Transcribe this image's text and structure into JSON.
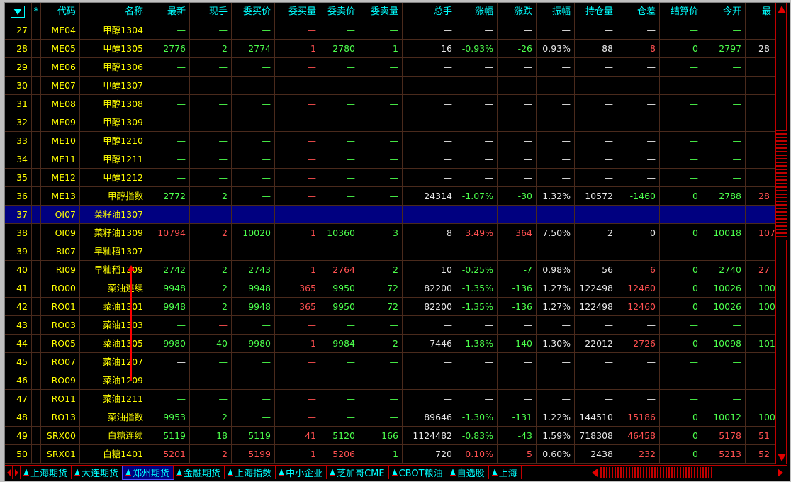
{
  "columns": [
    "",
    "*",
    "代码",
    "名称",
    "最新",
    "现手",
    "委买价",
    "委买量",
    "委卖价",
    "委卖量",
    "总手",
    "涨幅",
    "涨跌",
    "振幅",
    "持仓量",
    "仓差",
    "结算价",
    "今开",
    "最"
  ],
  "colors": {
    "g": "#4cff4c",
    "r": "#ff5050",
    "w": "#e8e8e8",
    "y": "#ffff00",
    "selected_row_bg": "#000080"
  },
  "selected_index": "37",
  "rows": [
    {
      "v": [
        "27",
        "",
        "ME04",
        "甲醇1304",
        "—",
        "—",
        "—",
        "—",
        "—",
        "—",
        "—",
        "—",
        "—",
        "—",
        "—",
        "—",
        "—",
        "—",
        ""
      ],
      "c": "gggrggwwwwwwggw"
    },
    {
      "v": [
        "28",
        "",
        "ME05",
        "甲醇1305",
        "2776",
        "2",
        "2774",
        "1",
        "2780",
        "1",
        "16",
        "-0.93%",
        "-26",
        "0.93%",
        "88",
        "8",
        "0",
        "2797",
        "28"
      ],
      "c": "gggrggwggwwrggw"
    },
    {
      "v": [
        "29",
        "",
        "ME06",
        "甲醇1306",
        "—",
        "—",
        "—",
        "—",
        "—",
        "—",
        "—",
        "—",
        "—",
        "—",
        "—",
        "—",
        "—",
        "—",
        ""
      ],
      "c": "gggrggwwwwwwggw"
    },
    {
      "v": [
        "30",
        "",
        "ME07",
        "甲醇1307",
        "—",
        "—",
        "—",
        "—",
        "—",
        "—",
        "—",
        "—",
        "—",
        "—",
        "—",
        "—",
        "—",
        "—",
        ""
      ],
      "c": "gggrggwwwwwwggw"
    },
    {
      "v": [
        "31",
        "",
        "ME08",
        "甲醇1308",
        "—",
        "—",
        "—",
        "—",
        "—",
        "—",
        "—",
        "—",
        "—",
        "—",
        "—",
        "—",
        "—",
        "—",
        ""
      ],
      "c": "gggrggwwwwwwggw"
    },
    {
      "v": [
        "32",
        "",
        "ME09",
        "甲醇1309",
        "—",
        "—",
        "—",
        "—",
        "—",
        "—",
        "—",
        "—",
        "—",
        "—",
        "—",
        "—",
        "—",
        "—",
        ""
      ],
      "c": "gggrggwwwwwwggw"
    },
    {
      "v": [
        "33",
        "",
        "ME10",
        "甲醇1210",
        "—",
        "—",
        "—",
        "—",
        "—",
        "—",
        "—",
        "—",
        "—",
        "—",
        "—",
        "—",
        "—",
        "—",
        ""
      ],
      "c": "gggrggwwwwwwggw"
    },
    {
      "v": [
        "34",
        "",
        "ME11",
        "甲醇1211",
        "—",
        "—",
        "—",
        "—",
        "—",
        "—",
        "—",
        "—",
        "—",
        "—",
        "—",
        "—",
        "—",
        "—",
        ""
      ],
      "c": "gggrggwwwwwwggw"
    },
    {
      "v": [
        "35",
        "",
        "ME12",
        "甲醇1212",
        "—",
        "—",
        "—",
        "—",
        "—",
        "—",
        "—",
        "—",
        "—",
        "—",
        "—",
        "—",
        "—",
        "—",
        ""
      ],
      "c": "gggrggwwwwwwggw"
    },
    {
      "v": [
        "36",
        "",
        "ME13",
        "甲醇指数",
        "2772",
        "2",
        "—",
        "—",
        "—",
        "—",
        "24314",
        "-1.07%",
        "-30",
        "1.32%",
        "10572",
        "-1460",
        "0",
        "2788",
        "28"
      ],
      "c": "gggrggwggwwgggr"
    },
    {
      "v": [
        "37",
        "",
        "OI07",
        "菜籽油1307",
        "—",
        "—",
        "—",
        "—",
        "—",
        "—",
        "—",
        "—",
        "—",
        "—",
        "—",
        "—",
        "—",
        "—",
        ""
      ],
      "c": "gggrggwwwwwwggw"
    },
    {
      "v": [
        "38",
        "",
        "OI09",
        "菜籽油1309",
        "10794",
        "2",
        "10020",
        "1",
        "10360",
        "3",
        "8",
        "3.49%",
        "364",
        "7.50%",
        "2",
        "0",
        "0",
        "10018",
        "107"
      ],
      "c": "rrgrggwrrwwwggr"
    },
    {
      "v": [
        "39",
        "",
        "RI07",
        "早籼稻1307",
        "—",
        "—",
        "—",
        "—",
        "—",
        "—",
        "—",
        "—",
        "—",
        "—",
        "—",
        "—",
        "—",
        "—",
        ""
      ],
      "c": "gggrggwwwwwwggw"
    },
    {
      "v": [
        "40",
        "",
        "RI09",
        "早籼稻1309",
        "2742",
        "2",
        "2743",
        "1",
        "2764",
        "2",
        "10",
        "-0.25%",
        "-7",
        "0.98%",
        "56",
        "6",
        "0",
        "2740",
        "27"
      ],
      "c": "gggrrgwggwwrggr"
    },
    {
      "v": [
        "41",
        "",
        "RO00",
        "菜油连续",
        "9948",
        "2",
        "9948",
        "365",
        "9950",
        "72",
        "82200",
        "-1.35%",
        "-136",
        "1.27%",
        "122498",
        "12460",
        "0",
        "10026",
        "100"
      ],
      "c": "gggrggwggwwrggg"
    },
    {
      "v": [
        "42",
        "",
        "RO01",
        "菜油1301",
        "9948",
        "2",
        "9948",
        "365",
        "9950",
        "72",
        "82200",
        "-1.35%",
        "-136",
        "1.27%",
        "122498",
        "12460",
        "0",
        "10026",
        "100"
      ],
      "c": "gggrggwggwwrggg"
    },
    {
      "v": [
        "43",
        "",
        "RO03",
        "菜油1303",
        "—",
        "—",
        "—",
        "—",
        "—",
        "—",
        "—",
        "—",
        "—",
        "—",
        "—",
        "—",
        "—",
        "—",
        ""
      ],
      "c": "grgrggwwwwwwggw"
    },
    {
      "v": [
        "44",
        "",
        "RO05",
        "菜油1305",
        "9980",
        "40",
        "9980",
        "1",
        "9984",
        "2",
        "7446",
        "-1.38%",
        "-140",
        "1.30%",
        "22012",
        "2726",
        "0",
        "10098",
        "101"
      ],
      "c": "gggrggwggwwrggg"
    },
    {
      "v": [
        "45",
        "",
        "RO07",
        "菜油1207",
        "—",
        "—",
        "—",
        "—",
        "—",
        "—",
        "—",
        "—",
        "—",
        "—",
        "—",
        "—",
        "—",
        "—",
        ""
      ],
      "c": "wggrggwwwwwwggw"
    },
    {
      "v": [
        "46",
        "",
        "RO09",
        "菜油1209",
        "—",
        "—",
        "—",
        "—",
        "—",
        "—",
        "—",
        "—",
        "—",
        "—",
        "—",
        "—",
        "—",
        "—",
        ""
      ],
      "c": "rggrggwwwwwwggw"
    },
    {
      "v": [
        "47",
        "",
        "RO11",
        "菜油1211",
        "—",
        "—",
        "—",
        "—",
        "—",
        "—",
        "—",
        "—",
        "—",
        "—",
        "—",
        "—",
        "—",
        "—",
        ""
      ],
      "c": "gggrggwwwwwwggw"
    },
    {
      "v": [
        "48",
        "",
        "RO13",
        "菜油指数",
        "9953",
        "2",
        "—",
        "—",
        "—",
        "—",
        "89646",
        "-1.30%",
        "-131",
        "1.22%",
        "144510",
        "15186",
        "0",
        "10012",
        "100"
      ],
      "c": "gggrggwggwwrggg"
    },
    {
      "v": [
        "49",
        "",
        "SRX00",
        "白糖连续",
        "5119",
        "18",
        "5119",
        "41",
        "5120",
        "166",
        "1124482",
        "-0.83%",
        "-43",
        "1.59%",
        "718308",
        "46458",
        "0",
        "5178",
        "51"
      ],
      "c": "gggrggwggwwrgrr"
    },
    {
      "v": [
        "50",
        "",
        "SRX01",
        "白糖1401",
        "5201",
        "2",
        "5199",
        "1",
        "5206",
        "1",
        "720",
        "0.10%",
        "5",
        "0.60%",
        "2438",
        "232",
        "0",
        "5213",
        "52"
      ],
      "c": "rrrrrgwrrwwrgrr"
    }
  ],
  "tabs": [
    {
      "label": "上海期货",
      "active": false
    },
    {
      "label": "大连期货",
      "active": false
    },
    {
      "label": "郑州期货",
      "active": true
    },
    {
      "label": "金融期货",
      "active": false
    },
    {
      "label": "上海指数",
      "active": false
    },
    {
      "label": "中小企业",
      "active": false
    },
    {
      "label": "芝加哥CME",
      "active": false
    },
    {
      "label": "CBOT粮油",
      "active": false
    },
    {
      "label": "自选股",
      "active": false
    },
    {
      "label": "上海",
      "active": false
    }
  ]
}
